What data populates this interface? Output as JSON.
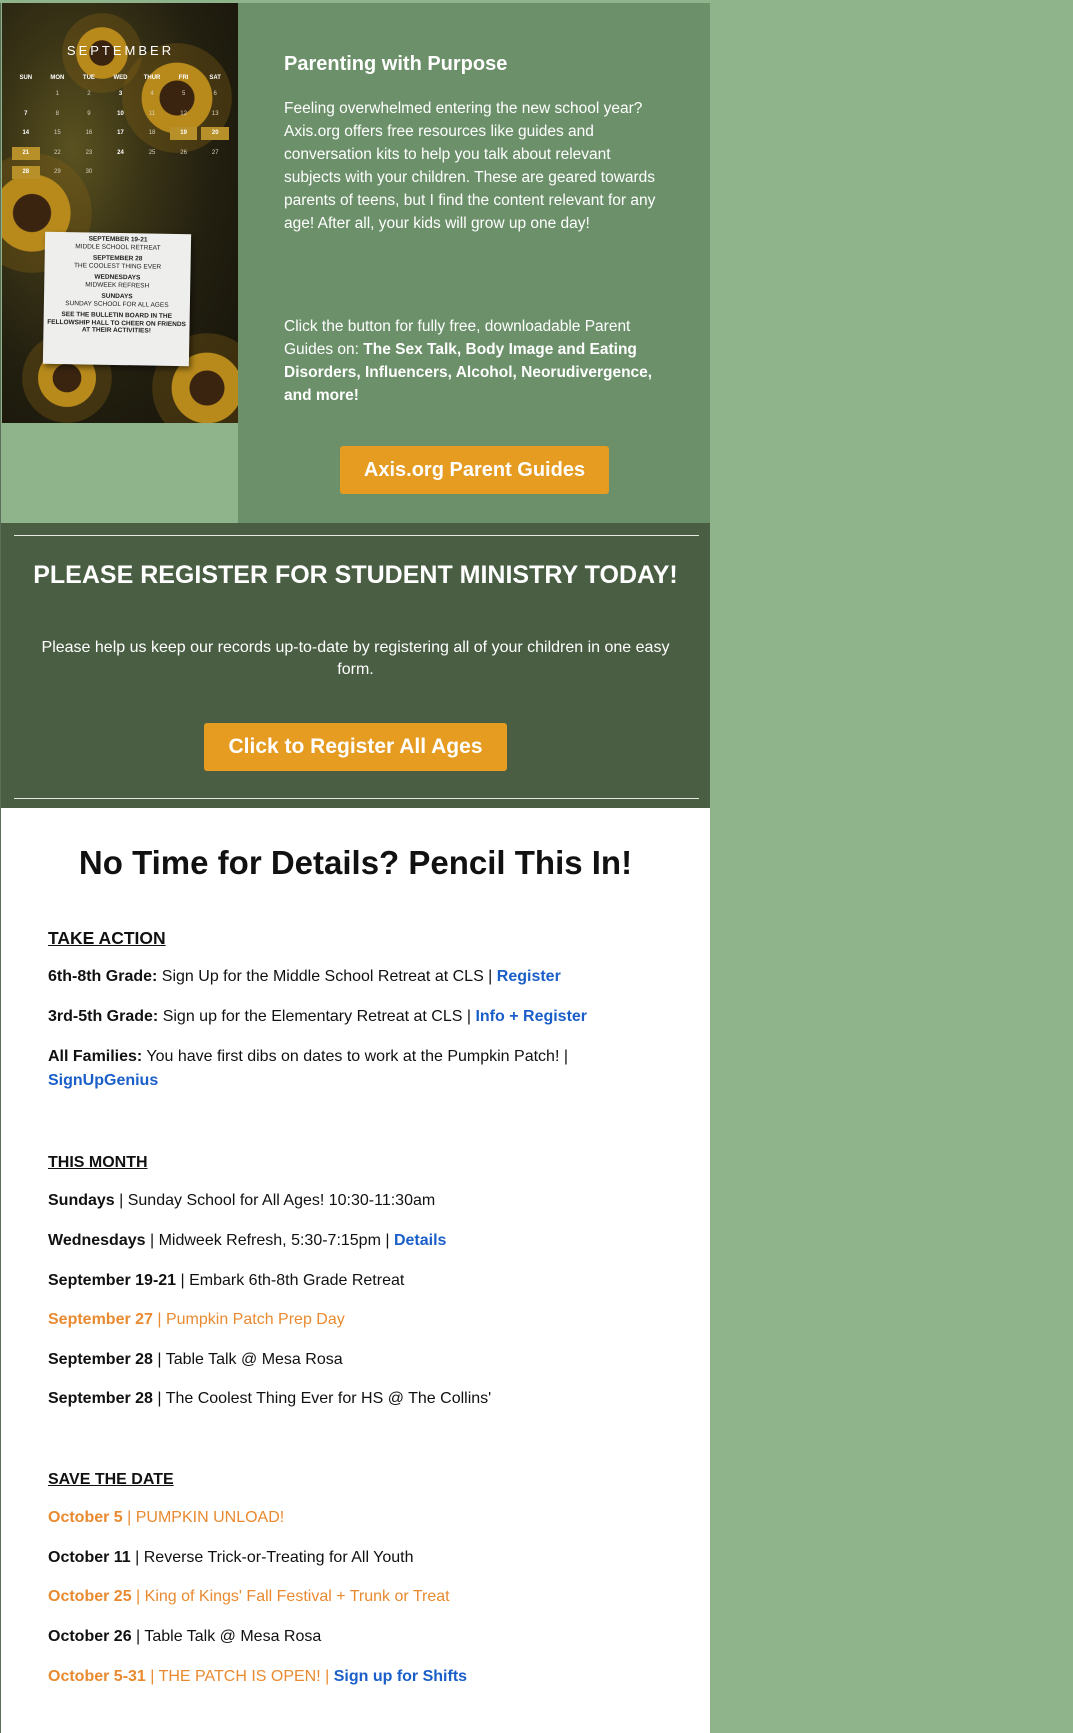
{
  "calendar": {
    "month": "SEPTEMBER",
    "weekdays": [
      "SUN",
      "MON",
      "TUE",
      "WED",
      "THUR",
      "FRI",
      "SAT"
    ],
    "rows": [
      [
        "",
        "1",
        "2",
        "3",
        "4",
        "5",
        "6"
      ],
      [
        "7",
        "8",
        "9",
        "10",
        "11",
        "12",
        "13"
      ],
      [
        "14",
        "15",
        "16",
        "17",
        "18",
        "19",
        "20"
      ],
      [
        "21",
        "22",
        "23",
        "24",
        "25",
        "26",
        "27"
      ],
      [
        "28",
        "29",
        "30",
        "",
        "",
        "",
        ""
      ]
    ],
    "note": [
      {
        "title": "SEPTEMBER 19-21",
        "text": "MIDDLE SCHOOL RETREAT"
      },
      {
        "title": "SEPTEMBER 28",
        "text": "THE COOLEST THING EVER"
      },
      {
        "title": "WEDNESDAYS",
        "text": "MIDWEEK REFRESH"
      },
      {
        "title": "SUNDAYS",
        "text": "SUNDAY SCHOOL FOR ALL AGES"
      },
      {
        "title": "SEE THE BULLETIN BOARD IN THE FELLOWSHIP HALL TO CHEER ON FRIENDS AT THEIR ACTIVITIES!",
        "text": ""
      }
    ]
  },
  "parenting": {
    "title": "Parenting with Purpose",
    "intro": "Feeling overwhelmed entering the new school year? Axis.org offers free resources like guides and conversation kits to help you talk about relevant subjects with your children. These are geared towards parents of teens, but I find the content relevant for any age! After all, your kids will grow up one day!",
    "click_prefix": "Click the button for fully free, downloadable Parent Guides on: ",
    "click_topics": "The Sex Talk, Body Image and Eating Disorders, Influencers, Alcohol, Neorudivergence, and more!",
    "button_label": "Axis.org Parent Guides"
  },
  "register": {
    "title": "PLEASE REGISTER FOR STUDENT MINISTRY TODAY!",
    "text": "Please help us keep our records up-to-date by registering all of your children in one easy form.",
    "button_label": "Click to Register All Ages"
  },
  "details": {
    "title": "No Time for Details? Pencil This In!",
    "take_action": {
      "heading": "TAKE ACTION",
      "items": [
        {
          "label": "6th-8th Grade:",
          "text": " Sign Up for the Middle School Retreat at CLS | ",
          "link": "Register"
        },
        {
          "label": "3rd-5th Grade:",
          "text": " Sign up for the Elementary Retreat at CLS | ",
          "link": "Info + Register"
        },
        {
          "label": "All Families:",
          "text": " You have first dibs on dates to work at the Pumpkin Patch! | ",
          "link": "SignUpGenius"
        }
      ]
    },
    "this_month": {
      "heading": "THIS MONTH",
      "items": [
        {
          "label": "Sundays",
          "text": " | Sunday School for All Ages! 10:30-11:30am",
          "link": ""
        },
        {
          "label": "Wednesdays",
          "text": " | Midweek Refresh, 5:30-7:15pm | ",
          "link": "Details"
        },
        {
          "label": "September 19-21",
          "text": " | Embark 6th-8th Grade Retreat",
          "link": ""
        },
        {
          "label": "September 27",
          "text": " | Pumpkin Patch Prep Day",
          "link": ""
        },
        {
          "label": "September 28",
          "text": " | Table Talk @ Mesa Rosa",
          "link": ""
        },
        {
          "label": "September 28",
          "text": " | The Coolest Thing Ever for HS @ The Collins'",
          "link": ""
        }
      ]
    },
    "save_the_date": {
      "heading": "SAVE THE DATE",
      "items": [
        {
          "label": "October 5",
          "text": " | PUMPKIN UNLOAD!",
          "link": ""
        },
        {
          "label": "October 11",
          "text": " | Reverse Trick-or-Treating for All Youth",
          "link": ""
        },
        {
          "label": "October 25",
          "text": " | King of Kings' Fall Festival + Trunk or Treat",
          "link": ""
        },
        {
          "label": "October 26",
          "text": " | Table Talk @ Mesa Rosa",
          "link": ""
        },
        {
          "label": "October 5-31",
          "text": " | THE PATCH IS OPEN! | ",
          "link": "Sign up for Shifts"
        }
      ]
    }
  },
  "colors": {
    "page_background": "#8fb38a",
    "hero_panel": "#6c916a",
    "register_panel": "#4a5e44",
    "button_orange": "#e69b21",
    "link_blue": "#1a5fc9",
    "highlight_orange": "#e98a30"
  }
}
